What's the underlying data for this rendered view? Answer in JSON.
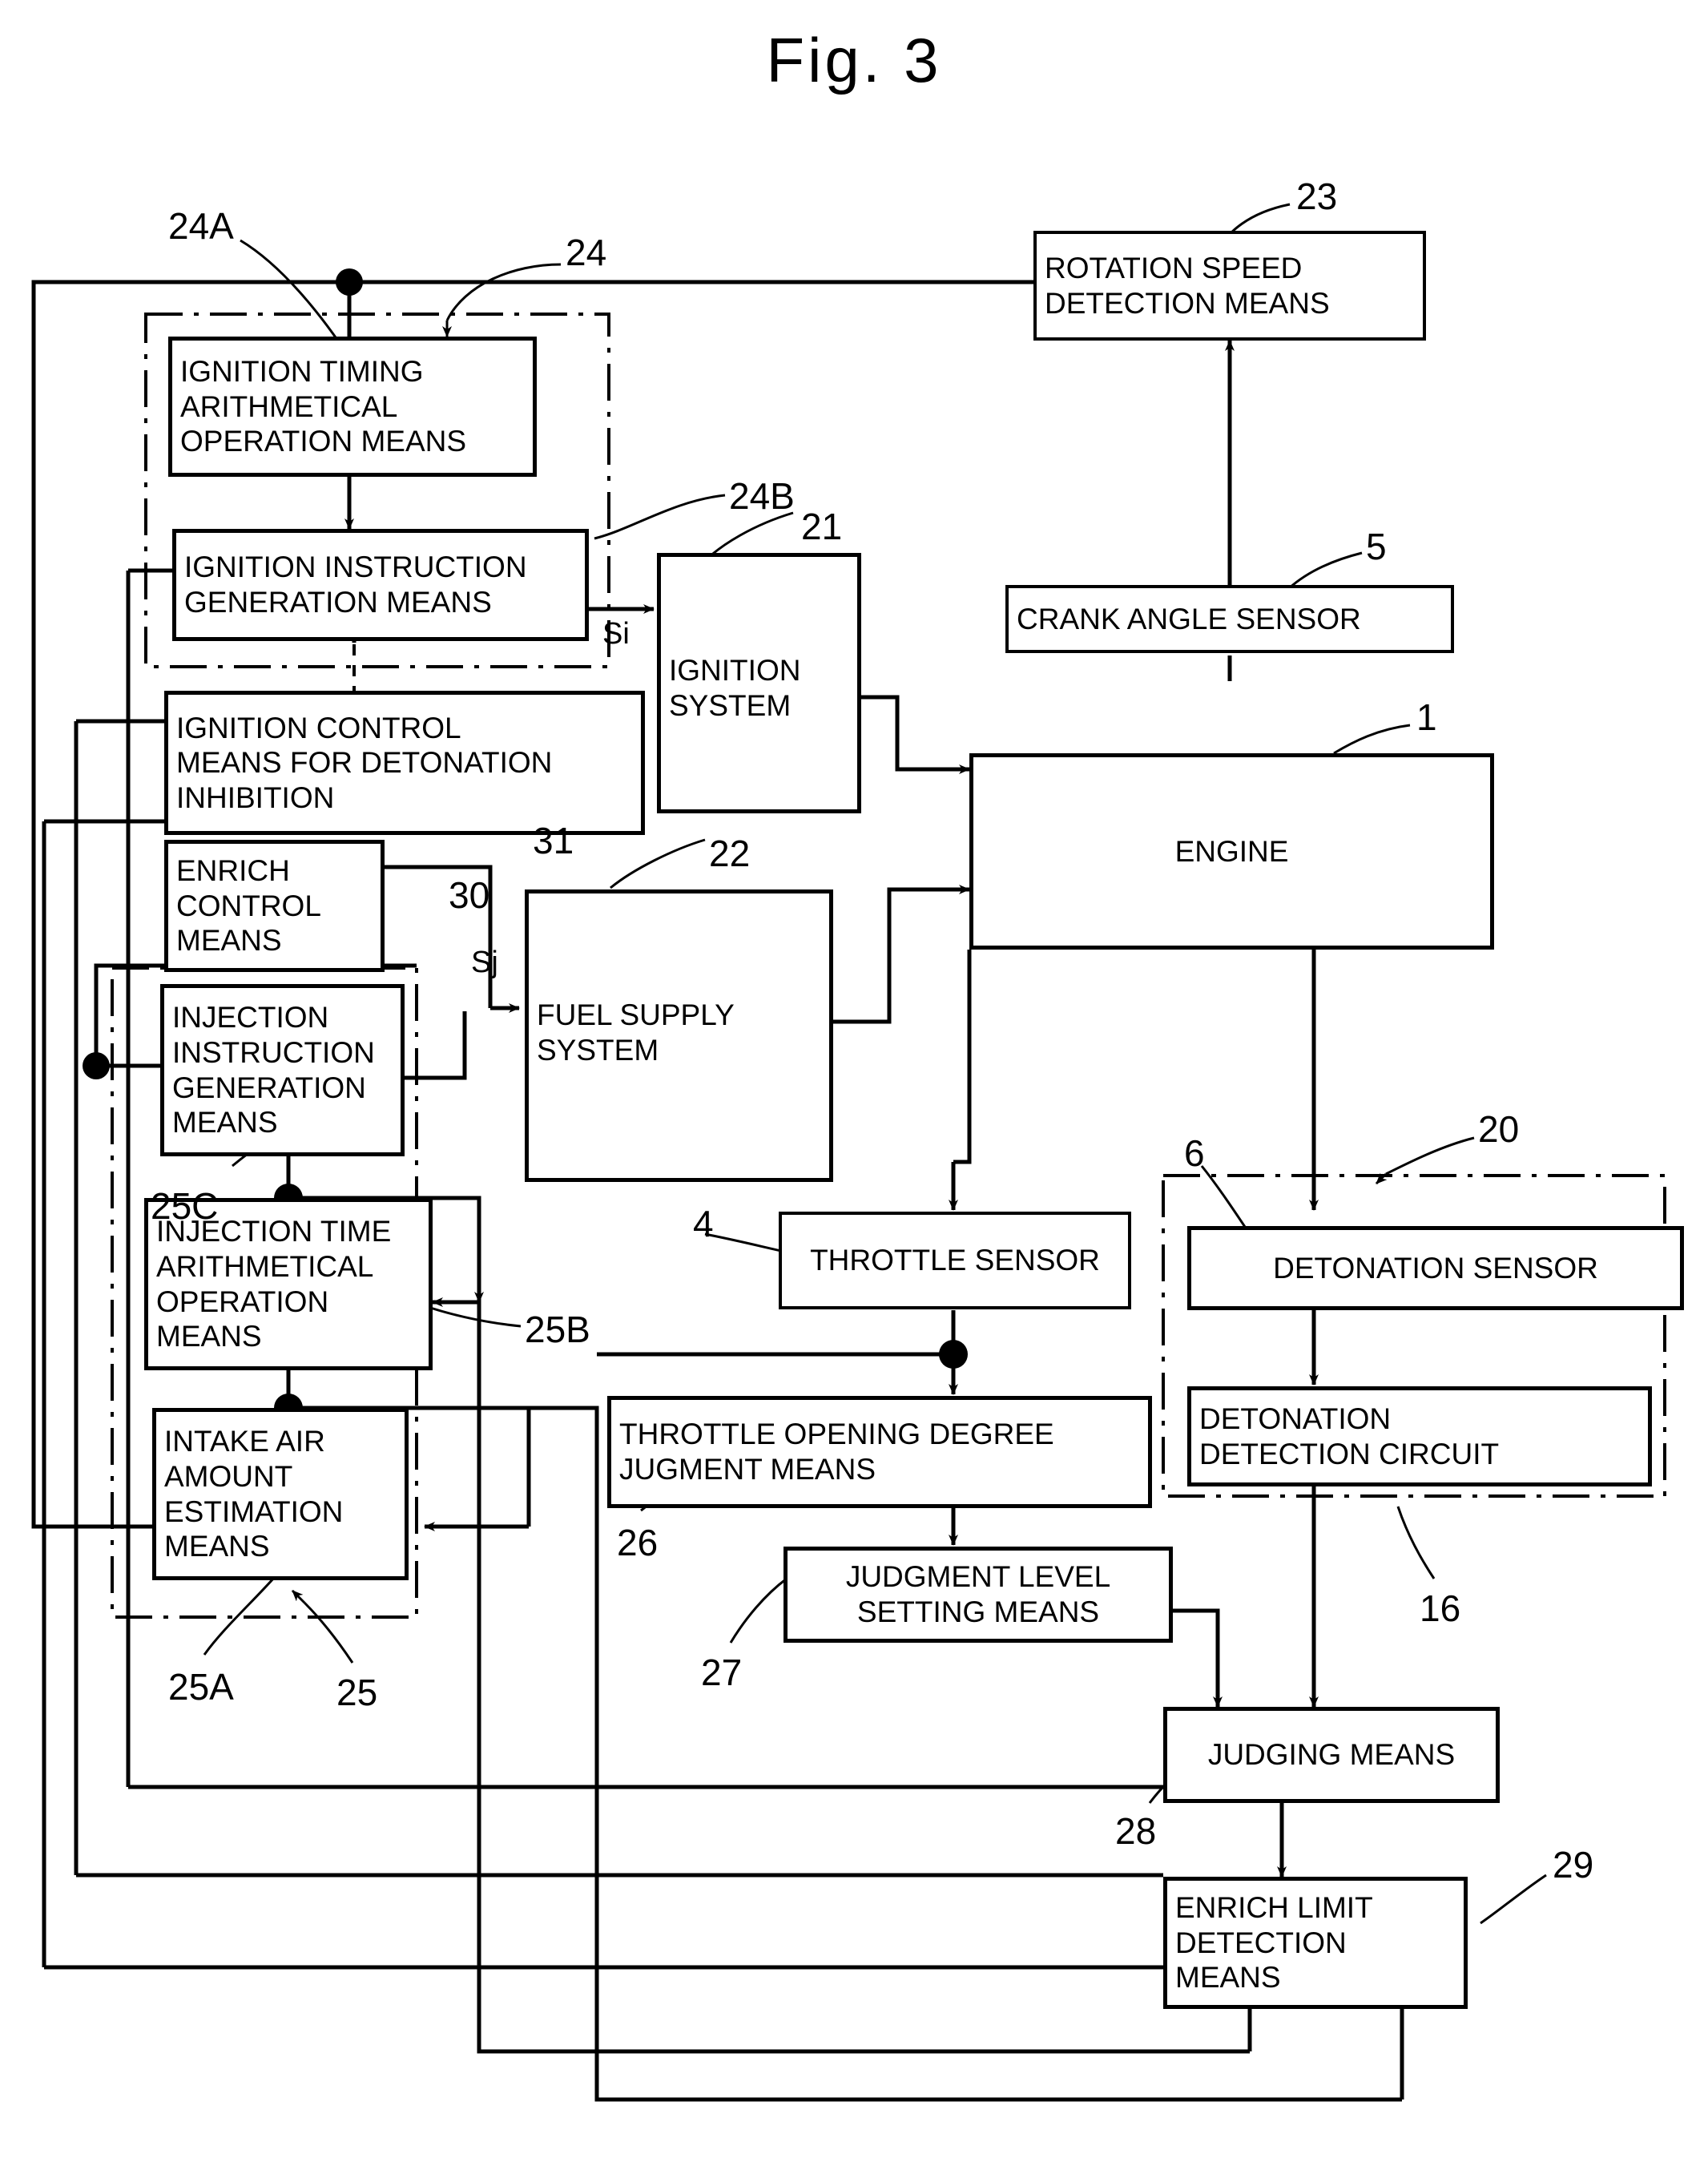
{
  "figure": {
    "title": "Fig. 3",
    "type": "patent block diagram",
    "subject": "engine detonation / enrich control block diagram"
  },
  "blocks": {
    "ignition_timing_arith": "IGNITION TIMING\nARITHMETICAL\nOPERATION MEANS",
    "ignition_instruction_gen": "IGNITION INSTRUCTION\nGENERATION MEANS",
    "ignition_control_detonation": "IGNITION CONTROL\nMEANS FOR DETONATION\nINHIBITION",
    "enrich_control": "ENRICH\nCONTROL\nMEANS",
    "injection_instruction_gen": "INJECTION\nINSTRUCTION\nGENERATION\nMEANS",
    "injection_time_arith": "INJECTION TIME\nARITHMETICAL\nOPERATION\nMEANS",
    "intake_air_estimation": "INTAKE AIR\nAMOUNT\nESTIMATION\nMEANS",
    "ignition_system": "IGNITION\nSYSTEM",
    "fuel_supply_system": "FUEL SUPPLY\nSYSTEM",
    "rotation_speed_detection": "ROTATION SPEED\nDETECTION MEANS",
    "crank_angle_sensor": "CRANK ANGLE SENSOR",
    "engine": "ENGINE",
    "throttle_sensor": "THROTTLE SENSOR",
    "throttle_opening_judgment": "THROTTLE OPENING DEGREE\nJUGMENT MEANS",
    "judgment_level_setting": "JUDGMENT LEVEL\nSETTING MEANS",
    "detonation_sensor": "DETONATION SENSOR",
    "detonation_detection_circuit": "DETONATION\nDETECTION CIRCUIT",
    "judging_means": "JUDGING MEANS",
    "enrich_limit_detection": "ENRICH LIMIT\nDETECTION\nMEANS"
  },
  "reference_numerals": {
    "n1": "1",
    "n4": "4",
    "n5": "5",
    "n6": "6",
    "n16": "16",
    "n20": "20",
    "n21": "21",
    "n22": "22",
    "n23": "23",
    "n24": "24",
    "n24A": "24A",
    "n24B": "24B",
    "n25": "25",
    "n25A": "25A",
    "n25B": "25B",
    "n25C": "25C",
    "n26": "26",
    "n27": "27",
    "n28": "28",
    "n29": "29",
    "n30": "30",
    "n31": "31"
  },
  "signal_labels": {
    "si": "Si",
    "sj": "Sj"
  },
  "colors": {
    "ink": "#000000",
    "paper": "#ffffff"
  }
}
